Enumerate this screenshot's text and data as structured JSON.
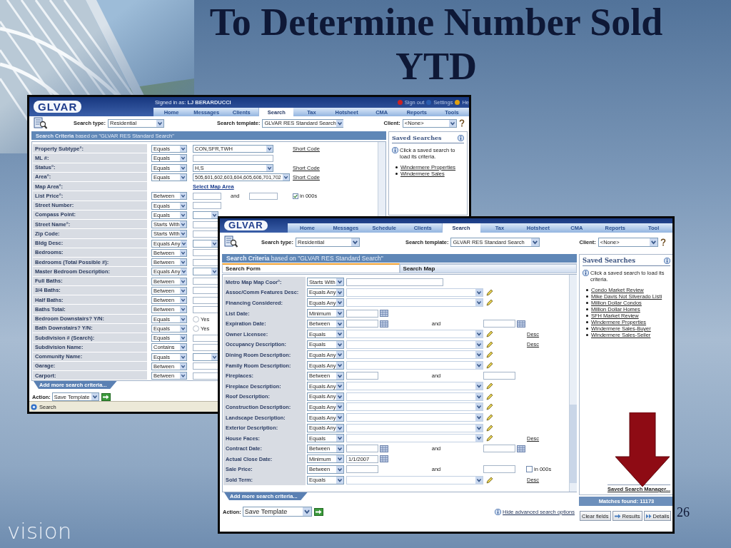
{
  "slide": {
    "title": "To Determine Number Sold YTD",
    "brand": "vision",
    "page_number": "26"
  },
  "back_window": {
    "logo": "GLVAR",
    "signed_in": "Signed in as: **LJ BERARDUCCI**",
    "header_links": [
      {
        "label": "Sign out",
        "color": "#cc2222"
      },
      {
        "label": "Settings",
        "color": "#2a5db0"
      },
      {
        "label": "He",
        "color": "#e0a010"
      }
    ],
    "tabs": [
      {
        "label": "Home",
        "selected": false
      },
      {
        "label": "Messages",
        "selected": false
      },
      {
        "label": "Clients",
        "selected": false
      },
      {
        "label": "Search",
        "selected": true
      },
      {
        "label": "Tax",
        "selected": false
      },
      {
        "label": "Hotsheet",
        "selected": false
      },
      {
        "label": "CMA",
        "selected": false
      },
      {
        "label": "Reports",
        "selected": false
      },
      {
        "label": "Tools",
        "selected": false
      }
    ],
    "search_type": {
      "label": "Search type:",
      "value": "Residential"
    },
    "template": {
      "label": "Search template:",
      "value": "GLVAR RES Standard Search"
    },
    "client": {
      "label": "Client:",
      "value": "<None>"
    },
    "criteria_title": "**Search Criteria** based on \"GLVAR RES Standard Search\"",
    "rows": [
      {
        "label": "Property Subtype°:",
        "operator": "Equals",
        "kind": "select",
        "value": "CON,SFR,TWH",
        "link": "Short Code"
      },
      {
        "label": "ML #:",
        "operator": "Equals",
        "kind": "text"
      },
      {
        "label": "Status°:",
        "operator": "Equals",
        "kind": "select",
        "value": "H,S",
        "link": "Short Code"
      },
      {
        "label": "Area°:",
        "operator": "Equals",
        "kind": "select",
        "value": "505,601,602,603,604,605,606,701,702",
        "link": "Short Code"
      },
      {
        "label": "Map Area°:",
        "kind": "map_link",
        "link": "Select Map Area"
      },
      {
        "label": "List Price°:",
        "operator": "Between",
        "kind": "range",
        "and": "and",
        "checkbox": {
          "label": "in 000s",
          "checked": true
        }
      },
      {
        "label": "Street Number:",
        "operator": "Equals",
        "kind": "short"
      },
      {
        "label": "Compass Point:",
        "operator": "Equals",
        "kind": "select"
      },
      {
        "label": "Street Name°:",
        "operator": "Starts With",
        "kind": "text"
      },
      {
        "label": "Zip Code:",
        "operator": "Starts With",
        "kind": "text"
      },
      {
        "label": "Bldg Desc:",
        "operator": "Equals Any",
        "kind": "select"
      },
      {
        "label": "Bedrooms:",
        "operator": "Between",
        "kind": "text"
      },
      {
        "label": "Bedrooms (Total Possible #):",
        "operator": "Between",
        "kind": "text"
      },
      {
        "label": "Master Bedroom Description:",
        "operator": "Equals Any",
        "kind": "select"
      },
      {
        "label": "Full Baths:",
        "operator": "Between",
        "kind": "text"
      },
      {
        "label": "3/4 Baths:",
        "operator": "Between",
        "kind": "text"
      },
      {
        "label": "Half Baths:",
        "operator": "Between",
        "kind": "text"
      },
      {
        "label": "Baths Total:",
        "operator": "Between",
        "kind": "text"
      },
      {
        "label": "Bedroom Downstairs? Y/N:",
        "operator": "Equals",
        "kind": "radio",
        "options": [
          {
            "label": "Yes",
            "selected": false
          }
        ]
      },
      {
        "label": "Bath Downstairs? Y/N:",
        "operator": "Equals",
        "kind": "radio",
        "options": [
          {
            "label": "Yes",
            "selected": false
          }
        ]
      },
      {
        "label": "Subdivision # (Search):",
        "operator": "Equals",
        "kind": "text"
      },
      {
        "label": "Subdivision Name:",
        "operator": "Contains",
        "kind": "text"
      },
      {
        "label": "Community Name:",
        "operator": "Equals",
        "kind": "select"
      },
      {
        "label": "Garage:",
        "operator": "Between",
        "kind": "text"
      },
      {
        "label": "Carport:",
        "operator": "Between",
        "kind": "text"
      }
    ],
    "add_more": "Add more search criteria...",
    "action": {
      "label": "Action:",
      "value": "Save Template"
    },
    "status": "Search",
    "saved_searches": {
      "title": "Saved Searches",
      "hint": "Click a saved search to load its criteria.",
      "items": [
        "Windermere Properties",
        "Windermere Sales"
      ]
    }
  },
  "front_window": {
    "logo": "GLVAR",
    "tabs": [
      {
        "label": "Home",
        "selected": false
      },
      {
        "label": "Messages",
        "selected": false
      },
      {
        "label": "Schedule",
        "selected": false
      },
      {
        "label": "Clients",
        "selected": false
      },
      {
        "label": "Search",
        "selected": true
      },
      {
        "label": "Tax",
        "selected": false
      },
      {
        "label": "Hotsheet",
        "selected": false
      },
      {
        "label": "CMA",
        "selected": false
      },
      {
        "label": "Reports",
        "selected": false
      },
      {
        "label": "Tool",
        "selected": false
      }
    ],
    "search_type": {
      "label": "Search type:",
      "value": "Residential"
    },
    "template": {
      "label": "Search template:",
      "value": "GLVAR RES Standard Search"
    },
    "client": {
      "label": "Client:",
      "value": "<None>"
    },
    "criteria_title": "**Search Criteria** based on \"GLVAR RES Standard Search\"",
    "form_tabs": [
      {
        "label": "Search Form",
        "selected": true
      },
      {
        "label": "Search Map",
        "selected": false
      }
    ],
    "rows": [
      {
        "label": "Metro Map Map Coor°:",
        "operator": "Starts With",
        "kind": "text"
      },
      {
        "label": "Assoc/Comm Features Desc:",
        "operator": "Equals Any",
        "kind": "multi"
      },
      {
        "label": "Financing Considered:",
        "operator": "Equals Any",
        "kind": "multi"
      },
      {
        "label": "List Date:",
        "operator": "Minimum",
        "kind": "date"
      },
      {
        "label": "Expiration Date:",
        "operator": "Between",
        "kind": "date_range",
        "and": "and"
      },
      {
        "label": "Owner Licensee:",
        "operator": "Equals",
        "kind": "multi",
        "desc": "Desc"
      },
      {
        "label": "Occupancy Description:",
        "operator": "Equals",
        "kind": "multi",
        "desc": "Desc"
      },
      {
        "label": "Dining Room Description:",
        "operator": "Equals Any",
        "kind": "multi"
      },
      {
        "label": "Family Room Description:",
        "operator": "Equals Any",
        "kind": "multi"
      },
      {
        "label": "Fireplaces:",
        "operator": "Between",
        "kind": "range",
        "and": "and"
      },
      {
        "label": "Fireplace Description:",
        "operator": "Equals Any",
        "kind": "multi"
      },
      {
        "label": "Roof Description:",
        "operator": "Equals Any",
        "kind": "multi"
      },
      {
        "label": "Construction Description:",
        "operator": "Equals Any",
        "kind": "multi"
      },
      {
        "label": "Landscape Description:",
        "operator": "Equals Any",
        "kind": "multi"
      },
      {
        "label": "Exterior Description:",
        "operator": "Equals Any",
        "kind": "multi"
      },
      {
        "label": "House Faces:",
        "operator": "Equals",
        "kind": "multi",
        "desc": "Desc"
      },
      {
        "label": "Contract Date:",
        "operator": "Between",
        "kind": "date_range",
        "and": "and"
      },
      {
        "label": "Actual Close Date:",
        "operator": "Minimum",
        "kind": "date",
        "value": "1/1/2007"
      },
      {
        "label": "Sale Price:",
        "operator": "Between",
        "kind": "range",
        "and": "and",
        "checkbox": {
          "label": "in 000s",
          "checked": false
        }
      },
      {
        "label": "Sold Term:",
        "operator": "Equals",
        "kind": "multi",
        "desc": "Desc"
      }
    ],
    "add_more": "Add more search criteria...",
    "action": {
      "label": "Action:",
      "value": "Save Template"
    },
    "hide_link": "Hide advanced search options",
    "saved_searches": {
      "title": "Saved Searches",
      "hint": "Click a saved search to load its criteria.",
      "items": [
        "Condo Market Review",
        "Mike Davis Not Silverado Listi",
        "Million Dollar Condos",
        "Million Dollar Homes",
        "SFH Market Review",
        "Windermere Properties",
        "Windermere Sales-Buyer",
        "Windermere Sales-Seller"
      ],
      "manager": "Saved Search Manager..."
    },
    "matches": "Matches found: 11173",
    "buttons": [
      {
        "label": "Clear fields",
        "kind": "plain"
      },
      {
        "label": "Results",
        "kind": "results"
      },
      {
        "label": "Details",
        "kind": "details"
      }
    ]
  }
}
